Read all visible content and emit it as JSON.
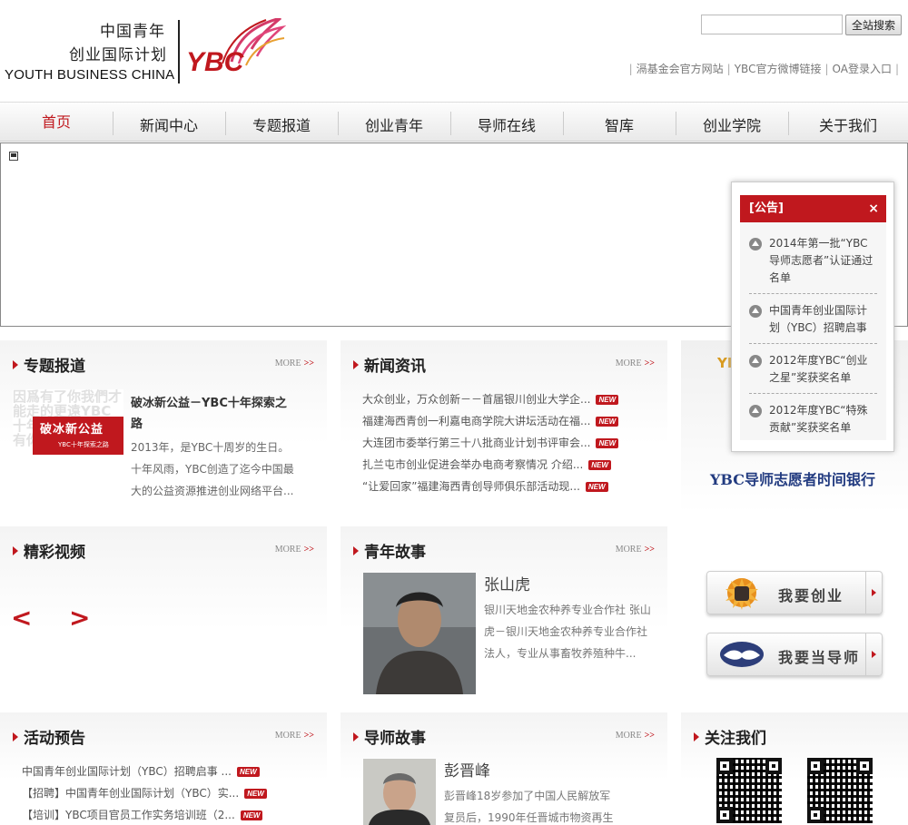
{
  "header": {
    "logo_cn_line1": "中国青年",
    "logo_cn_line2": "创业国际计划",
    "logo_en": "YOUTH BUSINESS CHINA",
    "logo_mark": "YBC",
    "search_placeholder": "",
    "search_button": "全站搜索",
    "top_links": [
      "滆基金会官方网站",
      "YBC官方微博链接",
      "OA登录入口"
    ]
  },
  "nav": {
    "items": [
      "首页",
      "新闻中心",
      "专题报道",
      "创业青年",
      "导师在线",
      "智库",
      "创业学院",
      "关于我们"
    ],
    "active_index": 0
  },
  "more_label": "MORE",
  "more_arrow": ">>",
  "new_badge": "NEW",
  "special": {
    "title": "专题报道",
    "img_text": "破冰新公益",
    "img_sub": "YBC十年探索之路",
    "img_bg_text": "因爲有了你我們才能走的更遠YBC十年探索之路感謝有你同行",
    "headline": "破冰新公益－YBC十年探索之路",
    "desc": "2013年，是YBC十周岁的生日。十年风雨，YBC创造了迄今中国最大的公益资源推进创业网络平台..."
  },
  "news": {
    "title": "新闻资讯",
    "items": [
      "大众创业，万众创新－－首届银川创业大学企...",
      "福建海西青创一利嘉电商学院大讲坛活动在福...",
      "大连团市委举行第三十八批商业计划书评审会...",
      "扎兰屯市创业促进会举办电商考察情况 介绍...",
      "“让爱回家”福建海西青创导师俱乐部活动现..."
    ]
  },
  "right_top": {
    "ybc_text": "YB",
    "bank_title": "YBC导师志愿者时间银行"
  },
  "video": {
    "title": "精彩视频",
    "prev": "<",
    "next": ">"
  },
  "youth_story": {
    "title": "青年故事",
    "name": "张山虎",
    "desc": "银川天地金农种养专业合作社 张山虎－银川天地金农种养专业合作社法人，专业从事畜牧养殖种牛..."
  },
  "buttons": {
    "start_business": "我要创业",
    "be_mentor": "我要当导师"
  },
  "events": {
    "title": "活动预告",
    "items": [
      "中国青年创业国际计划（YBC）招聘启事 ...",
      "【招聘】中国青年创业国际计划（YBC）实...",
      "【培训】YBC项目官员工作实务培训班（2..."
    ]
  },
  "mentor_story": {
    "title": "导师故事",
    "name": "彭晋峰",
    "desc": "彭晋峰18岁参加了中国人民解放军 复员后，1990年任晋城市物资再生"
  },
  "follow": {
    "title": "关注我们"
  },
  "notice": {
    "title": "[公告]",
    "close": "×",
    "items": [
      "2014年第一批“YBC导师志愿者”认证通过名单",
      "中国青年创业国际计划（YBC）招聘启事",
      "2012年度YBC“创业之星”奖获奖名单",
      "2012年度YBC“特殊贡献”奖获奖名单"
    ]
  },
  "colors": {
    "brand_red": "#c0181e",
    "navy": "#223b80",
    "gold": "#d89a1e"
  }
}
